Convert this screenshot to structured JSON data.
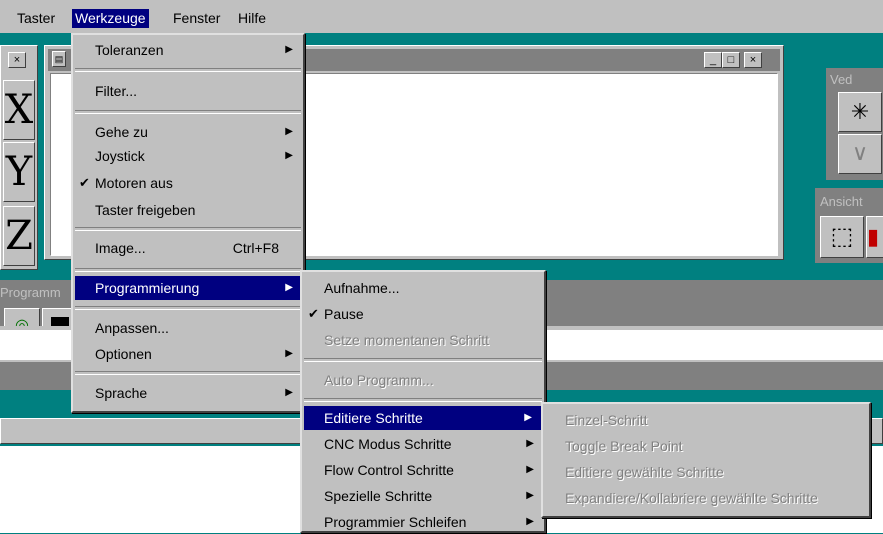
{
  "menubar": {
    "items": [
      {
        "label": "Taster",
        "u": "T"
      },
      {
        "label": "Werkzeuge",
        "u": "W"
      },
      {
        "label": "Fenster",
        "u": "F"
      },
      {
        "label": "Hilfe",
        "u": "H"
      }
    ]
  },
  "werkzeuge_menu": {
    "toleranzen": "Toleranzen",
    "filter": "Filter...",
    "gehe_zu": "Gehe zu",
    "joystick": "Joystick",
    "motoren_aus": "Motoren aus",
    "taster_freigeben": "Taster freigeben",
    "image": "Image...",
    "image_shortcut": "Ctrl+F8",
    "programmierung": "Programmierung",
    "anpassen": "Anpassen...",
    "optionen": "Optionen",
    "sprache": "Sprache",
    "checkmark": "✔"
  },
  "programmierung_menu": {
    "aufnahme": "Aufnahme...",
    "pause": "Pause",
    "setze_schritt": "Setze momentanen Schritt",
    "auto_programm": "Auto Programm...",
    "editiere_schritte": "Editiere Schritte",
    "cnc_modus": "CNC Modus Schritte",
    "flow_control": "Flow Control Schritte",
    "spezielle": "Spezielle Schritte",
    "schleifen": "Programmier Schleifen",
    "checkmark": "✔"
  },
  "editiere_menu": {
    "einzel": "Einzel-Schritt",
    "toggle": "Toggle Break Point",
    "editiere_gewaehlte": "Editiere gewählte Schritte",
    "expandiere": "Expandiere/Kollabriere gewählte Schritte"
  },
  "background": {
    "panel_ved": "Ved",
    "panel_ansicht": "Ansicht",
    "panel_programm": "Programm",
    "btn_x": "X",
    "btn_y": "Y",
    "btn_z": "Z",
    "win_min": "_",
    "win_max": "□",
    "win_close": "×"
  },
  "colors": {
    "desktop": "#008080",
    "face": "#c0c0c0",
    "highlight": "#000080"
  }
}
